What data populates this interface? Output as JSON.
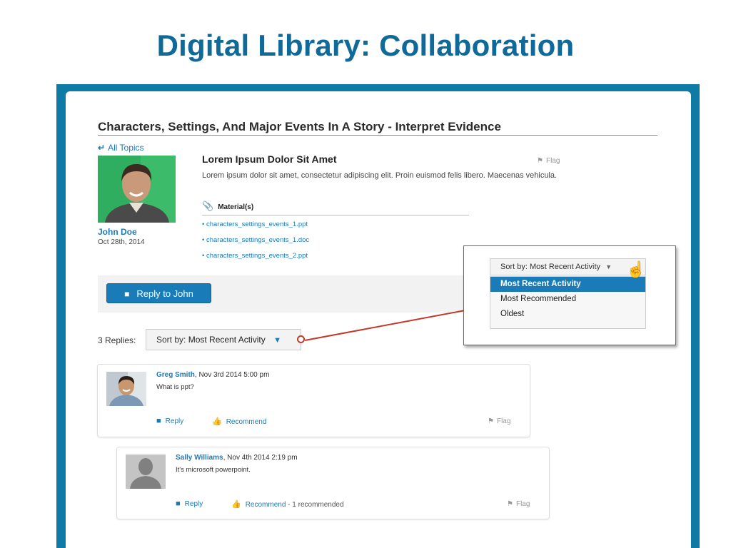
{
  "slide_title": "Digital Library: Collaboration",
  "topic": {
    "title": "Characters, Settings, And Major Events In A Story - Interpret Evidence",
    "back_link": "All Topics"
  },
  "post": {
    "author": "John Doe",
    "date": "Oct 28th, 2014",
    "title": "Lorem Ipsum Dolor Sit Amet",
    "body": "Lorem ipsum dolor sit amet, consectetur adipiscing elit. Proin euismod felis libero. Maecenas vehicula.",
    "flag_label": "Flag",
    "materials_label": "Material(s)",
    "materials": [
      "characters_settings_events_1.ppt",
      "characters_settings_events_1.doc",
      "characters_settings_events_2.ppt"
    ],
    "reply_button": "Reply to John"
  },
  "replies": {
    "count_label": "3 Replies:",
    "sort_prefix": "Sort by:",
    "sort_value": "Most Recent Activity"
  },
  "sort_popup": {
    "prefix": "Sort by:",
    "value": "Most Recent Activity",
    "options": [
      "Most Recent Activity",
      "Most Recommended",
      "Oldest"
    ],
    "selected_index": 0
  },
  "comments": [
    {
      "name": "Greg Smith",
      "meta": ", Nov 3rd 2014 5:00 pm",
      "text": "What is ppt?",
      "reply_label": "Reply",
      "recommend_label": "Recommend",
      "recommend_extra": "",
      "flag_label": "Flag"
    },
    {
      "name": "Sally Williams",
      "meta": ", Nov 4th 2014 2:19 pm",
      "text": "It's microsoft powerpoint.",
      "reply_label": "Reply",
      "recommend_label": "Recommend",
      "recommend_extra": " - 1 recommended",
      "flag_label": "Flag"
    }
  ],
  "colors": {
    "title_blue": "#0f6a9a",
    "frame_blue": "#0f7aa4",
    "link_blue": "#1a7bb9",
    "connector_red": "#c0392b"
  }
}
